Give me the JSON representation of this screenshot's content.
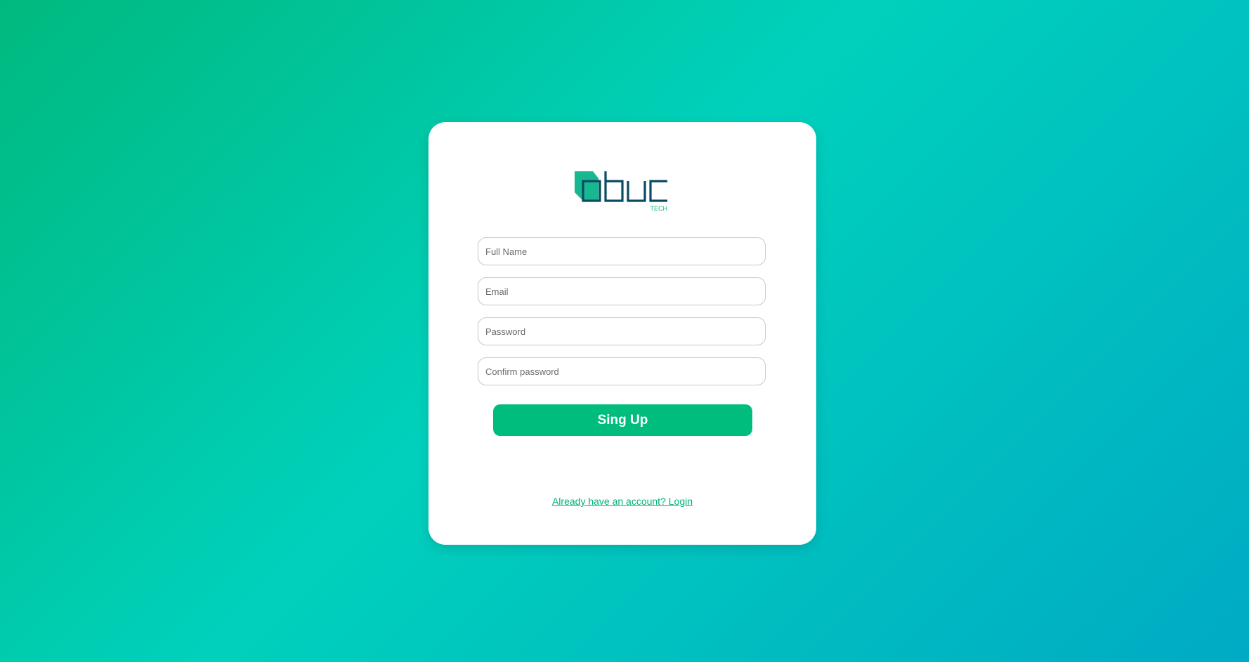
{
  "brand": {
    "logo_text": "obuc",
    "logo_subtext": "TECH",
    "logo_dark_color": "#0a4a63",
    "logo_accent_color": "#17b890"
  },
  "form": {
    "full_name_placeholder": "Full Name",
    "email_placeholder": "Email",
    "password_placeholder": "Password",
    "confirm_password_placeholder": "Confirm password",
    "submit_label": "Sing Up",
    "login_link_label": "Already have an account? Login"
  },
  "colors": {
    "background_gradient": [
      "#00b97e",
      "#00d1bc",
      "#00aac4"
    ],
    "button": "#00bd7e",
    "link": "#00b27a"
  }
}
